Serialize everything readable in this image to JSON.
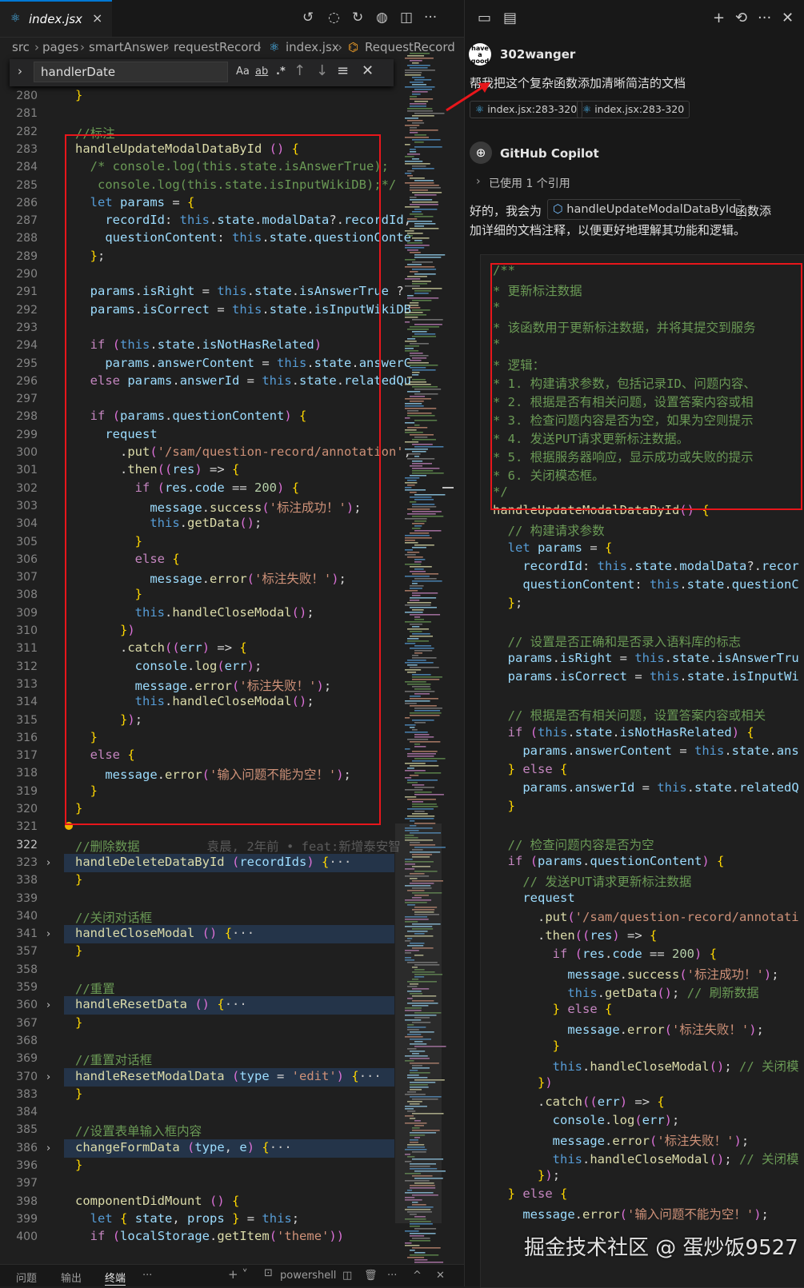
{
  "editor": {
    "tab": {
      "name": "index.jsx",
      "close": "×"
    },
    "breadcrumb": [
      "src",
      "pages",
      "smartAnswer",
      "requestRecord",
      "index.jsx",
      "RequestRecord"
    ],
    "find": {
      "value": "handlerDate",
      "opt_case": "Aa",
      "opt_word": "ab",
      "opt_regex": ".*"
    },
    "blame": "袁晨, 2年前 • feat:新增泰安智",
    "lines": [
      {
        "n": "280",
        "t": "}"
      },
      {
        "n": "281",
        "t": ""
      },
      {
        "n": "282",
        "t": "//标注"
      },
      {
        "n": "283",
        "t": "handleUpdateModalDataById () {"
      },
      {
        "n": "284",
        "t": "  /* console.log(this.state.isAnswerTrue);"
      },
      {
        "n": "285",
        "t": "   console.log(this.state.isInputWikiDB);*/"
      },
      {
        "n": "286",
        "t": "  let params = {"
      },
      {
        "n": "287",
        "t": "    recordId: this.state.modalData?.recordId,"
      },
      {
        "n": "288",
        "t": "    questionContent: this.state.questionConte"
      },
      {
        "n": "289",
        "t": "  };"
      },
      {
        "n": "290",
        "t": ""
      },
      {
        "n": "291",
        "t": "  params.isRight = this.state.isAnswerTrue ?"
      },
      {
        "n": "292",
        "t": "  params.isCorrect = this.state.isInputWikiDB"
      },
      {
        "n": "293",
        "t": ""
      },
      {
        "n": "294",
        "t": "  if (this.state.isNotHasRelated)"
      },
      {
        "n": "295",
        "t": "    params.answerContent = this.state.answerC"
      },
      {
        "n": "296",
        "t": "  else params.answerId = this.state.relatedQu"
      },
      {
        "n": "297",
        "t": ""
      },
      {
        "n": "298",
        "t": "  if (params.questionContent) {"
      },
      {
        "n": "299",
        "t": "    request"
      },
      {
        "n": "300",
        "t": "      .put('/sam/question-record/annotation',"
      },
      {
        "n": "301",
        "t": "      .then((res) => {"
      },
      {
        "n": "302",
        "t": "        if (res.code == 200) {"
      },
      {
        "n": "303",
        "t": "          message.success('标注成功！');"
      },
      {
        "n": "304",
        "t": "          this.getData();"
      },
      {
        "n": "305",
        "t": "        }"
      },
      {
        "n": "306",
        "t": "        else {"
      },
      {
        "n": "307",
        "t": "          message.error('标注失败！');"
      },
      {
        "n": "308",
        "t": "        }"
      },
      {
        "n": "309",
        "t": "        this.handleCloseModal();"
      },
      {
        "n": "310",
        "t": "      })"
      },
      {
        "n": "311",
        "t": "      .catch((err) => {"
      },
      {
        "n": "312",
        "t": "        console.log(err);"
      },
      {
        "n": "313",
        "t": "        message.error('标注失败！');"
      },
      {
        "n": "314",
        "t": "        this.handleCloseModal();"
      },
      {
        "n": "315",
        "t": "      });"
      },
      {
        "n": "316",
        "t": "  }"
      },
      {
        "n": "317",
        "t": "  else {"
      },
      {
        "n": "318",
        "t": "    message.error('输入问题不能为空！');"
      },
      {
        "n": "319",
        "t": "  }"
      },
      {
        "n": "320",
        "t": "}"
      },
      {
        "n": "321",
        "t": ""
      },
      {
        "n": "322",
        "t": "//删除数据"
      },
      {
        "n": "323",
        "t": "handleDeleteDataById (recordIds) {···"
      },
      {
        "n": "338",
        "t": "}"
      },
      {
        "n": "339",
        "t": ""
      },
      {
        "n": "340",
        "t": "//关闭对话框"
      },
      {
        "n": "341",
        "t": "handleCloseModal () {···"
      },
      {
        "n": "357",
        "t": "}"
      },
      {
        "n": "358",
        "t": ""
      },
      {
        "n": "359",
        "t": "//重置"
      },
      {
        "n": "360",
        "t": "handleResetData () {···"
      },
      {
        "n": "367",
        "t": "}"
      },
      {
        "n": "368",
        "t": ""
      },
      {
        "n": "369",
        "t": "//重置对话框"
      },
      {
        "n": "370",
        "t": "handleResetModalData (type = 'edit') {···"
      },
      {
        "n": "383",
        "t": "}"
      },
      {
        "n": "384",
        "t": ""
      },
      {
        "n": "385",
        "t": "//设置表单输入框内容"
      },
      {
        "n": "386",
        "t": "changeFormData (type, e) {···"
      },
      {
        "n": "396",
        "t": "}"
      },
      {
        "n": "397",
        "t": ""
      },
      {
        "n": "398",
        "t": "componentDidMount () {"
      },
      {
        "n": "399",
        "t": "  let { state, props } = this;"
      },
      {
        "n": "400",
        "t": "  if (localStorage.getItem('theme'))"
      }
    ],
    "panel": {
      "problems": "问题",
      "output": "输出",
      "terminal": "终端",
      "more": "···",
      "shell": "powershell"
    }
  },
  "chat": {
    "user": {
      "name": "302wanger",
      "avatar_text": "have a good",
      "message": "帮我把这个复杂函数添加清晰简洁的文档"
    },
    "refs": [
      "index.jsx:283-320",
      "index.jsx:283-320"
    ],
    "copilot": {
      "name": "GitHub Copilot",
      "used_refs": "已使用 1 个引用",
      "reply_prefix": "好的，我会为",
      "reply_symbol": "handleUpdateModalDataById",
      "reply_suffix": "函数添",
      "reply_line2": "加详细的文档注释，以便更好地理解其功能和逻辑。"
    },
    "code": [
      "/**",
      "* 更新标注数据",
      "*",
      "* 该函数用于更新标注数据，并将其提交到服务",
      "*",
      "* 逻辑：",
      "* 1. 构建请求参数，包括记录ID、问题内容、",
      "* 2. 根据是否有相关问题，设置答案内容或相",
      "* 3. 检查问题内容是否为空，如果为空则提示",
      "* 4. 发送PUT请求更新标注数据。",
      "* 5. 根据服务器响应，显示成功或失败的提示",
      "* 6. 关闭模态框。",
      "*/",
      "handleUpdateModalDataById() {",
      "  // 构建请求参数",
      "  let params = {",
      "    recordId: this.state.modalData?.recor",
      "    questionContent: this.state.questionC",
      "  };",
      "",
      "  // 设置是否正确和是否录入语料库的标志",
      "  params.isRight = this.state.isAnswerTru",
      "  params.isCorrect = this.state.isInputWi",
      "",
      "  // 根据是否有相关问题，设置答案内容或相关",
      "  if (this.state.isNotHasRelated) {",
      "    params.answerContent = this.state.ans",
      "  } else {",
      "    params.answerId = this.state.relatedQ",
      "  }",
      "",
      "  // 检查问题内容是否为空",
      "  if (params.questionContent) {",
      "    // 发送PUT请求更新标注数据",
      "    request",
      "      .put('/sam/question-record/annotati",
      "      .then((res) => {",
      "        if (res.code == 200) {",
      "          message.success('标注成功！');",
      "          this.getData(); // 刷新数据",
      "        } else {",
      "          message.error('标注失败！');",
      "        }",
      "        this.handleCloseModal(); // 关闭模",
      "      })",
      "      .catch((err) => {",
      "        console.log(err);",
      "        message.error('标注失败！');",
      "        this.handleCloseModal(); // 关闭模",
      "      });",
      "  } else {",
      "    message.error('输入问题不能为空！');"
    ]
  },
  "watermark": "掘金技术社区 @ 蛋炒饭9527",
  "colors": {
    "accent": "#0078d4",
    "highlight_box": "#e8161b",
    "keyword": "#569cd6",
    "function": "#dcdcaa",
    "string": "#ce9178",
    "comment": "#6a9955",
    "property": "#9cdcfe"
  }
}
